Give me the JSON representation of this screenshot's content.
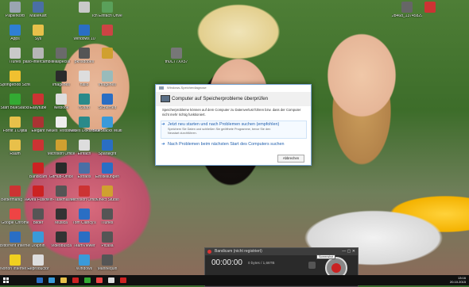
{
  "desktop_icons": [
    {
      "label": "Papierkorb",
      "col": 0,
      "row": 0,
      "color": "#9aa5b1",
      "icon": "recycle-bin-icon"
    },
    {
      "label": "MaseKart",
      "col": 1,
      "row": 0,
      "color": "#4a6fa5",
      "icon": "app-icon"
    },
    {
      "label": "",
      "col": 3,
      "row": 0,
      "color": "#c9c9c9",
      "icon": "file-icon"
    },
    {
      "label": "Ich Einfach Unverbesserlich",
      "col": 4,
      "row": 0,
      "color": "#5aa05a",
      "icon": "app-icon"
    },
    {
      "label": "Apps",
      "col": 0,
      "row": 1,
      "color": "#2f7fd4",
      "icon": "apps-icon"
    },
    {
      "label": "Sys",
      "col": 1,
      "row": 1,
      "color": "#e8c04a",
      "icon": "folder-icon"
    },
    {
      "label": "Windows 10",
      "col": 3,
      "row": 1,
      "color": "#2a6ec4",
      "icon": "music-icon"
    },
    {
      "label": "",
      "col": 4,
      "row": 1,
      "color": "#c44",
      "icon": "app-icon"
    },
    {
      "label": "iTunes",
      "col": 0,
      "row": 2,
      "color": "#c9c9c9",
      "icon": "itunes-icon"
    },
    {
      "label": "paso-intercambio",
      "col": 1,
      "row": 2,
      "color": "#b6b6b6",
      "icon": "app-icon"
    },
    {
      "label": "elaspecial",
      "col": 2,
      "row": 2,
      "color": "#6a6a6a",
      "icon": "app-icon"
    },
    {
      "label": "pkhsdobes",
      "col": 3,
      "row": 2,
      "color": "#555",
      "icon": "app-icon"
    },
    {
      "label": "",
      "col": 4,
      "row": 2,
      "color": "#d0a030",
      "icon": "folder-icon"
    },
    {
      "label": "SpongeBob Schwammkopf",
      "col": 0,
      "row": 3,
      "color": "#f0c030",
      "icon": "app-icon"
    },
    {
      "label": "imagenes",
      "col": 2,
      "row": 3,
      "color": "#2b2b2b",
      "icon": "image-icon"
    },
    {
      "label": "hallo",
      "col": 3,
      "row": 3,
      "color": "#ddd",
      "icon": "file-icon"
    },
    {
      "label": "imagenes",
      "col": 4,
      "row": 3,
      "color": "#9bb",
      "icon": "image-icon"
    },
    {
      "label": "Start BlueStacks",
      "col": 0,
      "row": 4,
      "color": "#3a3",
      "icon": "bluestacks-icon"
    },
    {
      "label": "Easytube",
      "col": 1,
      "row": 4,
      "color": "#c33",
      "icon": "app-icon"
    },
    {
      "label": "Netbook",
      "col": 2,
      "row": 4,
      "color": "#ddd",
      "icon": "file-icon"
    },
    {
      "label": "h2alto",
      "col": 3,
      "row": 4,
      "color": "#2a8a8a",
      "icon": "app-icon"
    },
    {
      "label": "Sicherheit",
      "col": 4,
      "row": 4,
      "color": "#2a6ec4",
      "icon": "app-icon"
    },
    {
      "label": "Fornit 1 Dijital",
      "col": 0,
      "row": 5,
      "color": "#e8c04a",
      "icon": "folder-icon"
    },
    {
      "label": "Elegant",
      "col": 1,
      "row": 5,
      "color": "#a33",
      "icon": "app-icon"
    },
    {
      "label": "Neues Textdokument",
      "col": 2,
      "row": 5,
      "color": "#eee",
      "icon": "file-icon"
    },
    {
      "label": "Neues Dokument",
      "col": 3,
      "row": 5,
      "color": "#2a8a8a",
      "icon": "app-icon"
    },
    {
      "label": "BlueStacks Multi",
      "col": 4,
      "row": 5,
      "color": "#3a9ad9",
      "icon": "app-icon"
    },
    {
      "label": "Raum",
      "col": 0,
      "row": 6,
      "color": "#e8c04a",
      "icon": "folder-icon"
    },
    {
      "label": "",
      "col": 1,
      "row": 6,
      "color": "#c33",
      "icon": "app-icon"
    },
    {
      "label": "Microsoft Office",
      "col": 2,
      "row": 6,
      "color": "#d0a030",
      "icon": "app-icon"
    },
    {
      "label": "Einfach",
      "col": 3,
      "row": 6,
      "color": "#ddd",
      "icon": "file-icon"
    },
    {
      "label": "Sparalight",
      "col": 4,
      "row": 6,
      "color": "#2a6ec4",
      "icon": "image-icon"
    },
    {
      "label": "Bandicam",
      "col": 1,
      "row": 7,
      "color": "#c22",
      "icon": "bandicam-icon"
    },
    {
      "label": "GitHub-Office",
      "col": 2,
      "row": 7,
      "color": "#2a2a2a",
      "icon": "app-icon"
    },
    {
      "label": "Extraos",
      "col": 3,
      "row": 7,
      "color": "#4a6fa5",
      "icon": "app-icon"
    },
    {
      "label": "Einstellungen",
      "col": 4,
      "row": 7,
      "color": "#2a6ec4",
      "icon": "app-icon"
    },
    {
      "label": "Bettermanig Teil",
      "col": 0,
      "row": 8,
      "color": "#c33",
      "icon": "app-icon"
    },
    {
      "label": "Avira Fusion",
      "col": 1,
      "row": 8,
      "color": "#c22",
      "icon": "app-icon"
    },
    {
      "label": "Win-Taskmaster verschiedenes",
      "col": 2,
      "row": 8,
      "color": "#555",
      "icon": "app-icon"
    },
    {
      "label": "Microsoft Office",
      "col": 3,
      "row": 8,
      "color": "#c33",
      "icon": "app-icon"
    },
    {
      "label": "Kinect Studio",
      "col": 4,
      "row": 8,
      "color": "#d0a030",
      "icon": "app-icon"
    },
    {
      "label": "Google Chrome",
      "col": 0,
      "row": 9,
      "color": "#e44",
      "icon": "chrome-icon"
    },
    {
      "label": "Bilder",
      "col": 1,
      "row": 9,
      "color": "#555",
      "icon": "image-icon"
    },
    {
      "label": "Musica",
      "col": 2,
      "row": 9,
      "color": "#333",
      "icon": "app-icon"
    },
    {
      "label": "Tom Clancy's",
      "col": 3,
      "row": 9,
      "color": "#2a6ec4",
      "icon": "app-icon"
    },
    {
      "label": "iTunes",
      "col": 4,
      "row": 9,
      "color": "#555",
      "icon": "app-icon"
    },
    {
      "label": "Bittorrent Internet Explorer",
      "col": 0,
      "row": 10,
      "color": "#2a6ec4",
      "icon": "app-icon"
    },
    {
      "label": "Dolphin",
      "col": 1,
      "row": 10,
      "color": "#3a9ad9",
      "icon": "app-icon"
    },
    {
      "label": "Videobusca",
      "col": 2,
      "row": 10,
      "color": "#333",
      "icon": "app-icon"
    },
    {
      "label": "TeamViewer",
      "col": 3,
      "row": 10,
      "color": "#2a6ec4",
      "icon": "app-icon"
    },
    {
      "label": "Picasa",
      "col": 4,
      "row": 10,
      "color": "#555",
      "icon": "app-icon"
    },
    {
      "label": "Norton Internet Security",
      "col": 0,
      "row": 11,
      "color": "#f0d020",
      "icon": "norton-icon"
    },
    {
      "label": "Reproductor",
      "col": 1,
      "row": 11,
      "color": "#ddd",
      "icon": "file-icon"
    },
    {
      "label": "Windows",
      "col": 3,
      "row": 11,
      "color": "#3a9ad9",
      "icon": "app-icon"
    },
    {
      "label": "Mannequin",
      "col": 4,
      "row": 11,
      "color": "#555",
      "icon": "app-icon"
    },
    {
      "label": "th0CT7XX57",
      "col": 7,
      "row": 2,
      "color": "#777",
      "icon": "image-icon"
    },
    {
      "label": "2b46d_13745829...",
      "col": 17,
      "row": 0,
      "color": "#666",
      "icon": "image-icon"
    },
    {
      "label": "",
      "col": 18,
      "row": 0,
      "color": "#c33",
      "icon": "app-icon"
    }
  ],
  "dialog": {
    "titlebar": "Windows-Speicherdiagnose",
    "heading": "Computer auf Speicherprobleme überprüfen",
    "description": "Speicherprobleme können auf dem Computer zu Datenverlust führen bzw. dass der Computer nicht mehr richtig funktioniert.",
    "option1": "Jetzt neu starten und nach Problemen suchen (empfohlen)",
    "option1_sub": "Speichern Sie Daten und schließen Sie geöffnete Programme, bevor Sie den Neustart durchführen.",
    "option2": "Nach Problemen beim nächsten Start des Computers suchen",
    "cancel": "Abbrechen"
  },
  "bandicam": {
    "title": "Bandicam (nicht registriert)",
    "time": "00:00:00",
    "bytes": "0 bytes / 1,66TB",
    "screenshot_tip": "Screenshot"
  },
  "taskbar": {
    "time": "13:16",
    "date": "20.10.2015",
    "items": [
      "#2a6ec4",
      "#3a9ad9",
      "#e8c04a",
      "#c22",
      "#3a3",
      "#e44",
      "#ddd",
      "#c22"
    ]
  }
}
